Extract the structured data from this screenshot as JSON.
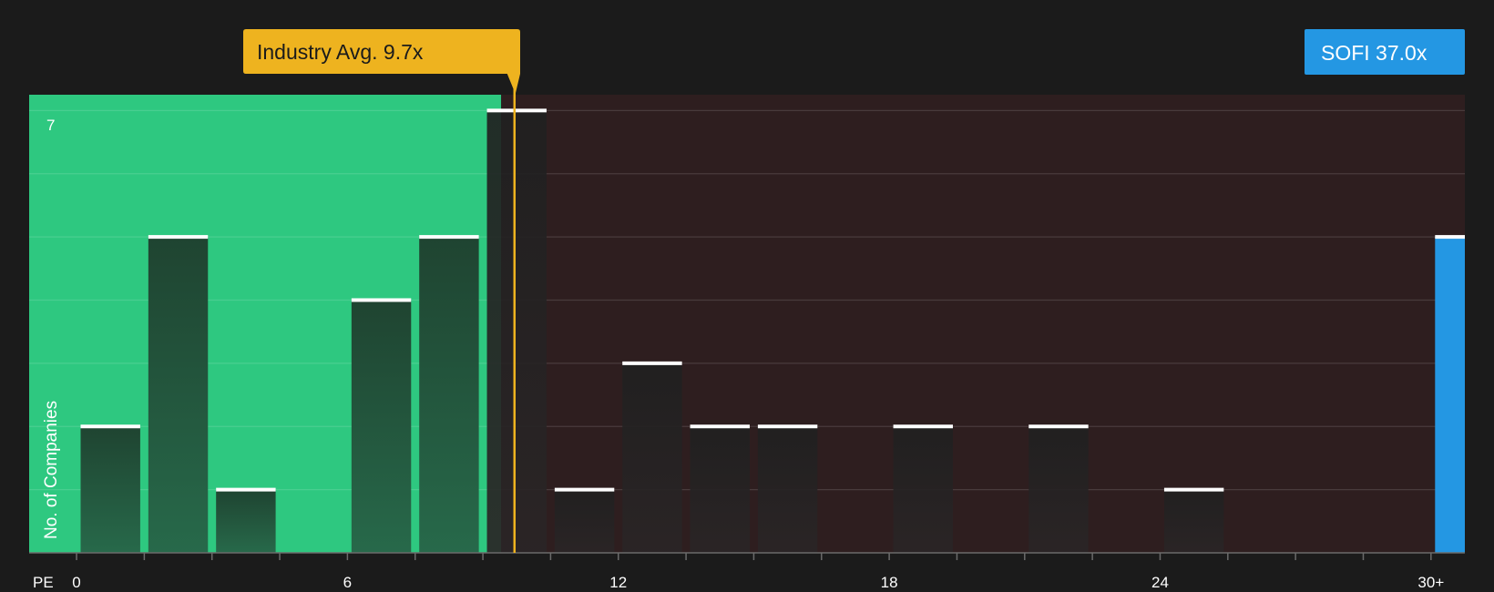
{
  "chart_data": {
    "type": "bar",
    "xlabel": "PE",
    "ylabel": "No. of Companies",
    "x_ticks": [
      "0",
      "6",
      "12",
      "18",
      "24",
      "30+"
    ],
    "x_tick_values": [
      0,
      6,
      12,
      18,
      24,
      30
    ],
    "y_tick_labels": [
      "7"
    ],
    "xlim": [
      -1.05,
      30.75
    ],
    "ylim": [
      0,
      7.25
    ],
    "bin_width": 1.5,
    "bins": [
      {
        "start": 0.0,
        "count": 2
      },
      {
        "start": 1.5,
        "count": 5
      },
      {
        "start": 3.0,
        "count": 1
      },
      {
        "start": 4.5,
        "count": 0
      },
      {
        "start": 6.0,
        "count": 4
      },
      {
        "start": 7.5,
        "count": 5
      },
      {
        "start": 9.0,
        "count": 7
      },
      {
        "start": 10.5,
        "count": 1
      },
      {
        "start": 12.0,
        "count": 3
      },
      {
        "start": 13.5,
        "count": 2
      },
      {
        "start": 15.0,
        "count": 2
      },
      {
        "start": 16.5,
        "count": 0
      },
      {
        "start": 18.0,
        "count": 2
      },
      {
        "start": 19.5,
        "count": 0
      },
      {
        "start": 21.0,
        "count": 2
      },
      {
        "start": 22.5,
        "count": 0
      },
      {
        "start": 24.0,
        "count": 1
      },
      {
        "start": 25.5,
        "count": 0
      },
      {
        "start": 27.0,
        "count": 0
      },
      {
        "start": 28.5,
        "count": 0
      }
    ],
    "highlight_bar": {
      "label": "SOFI 37.0x",
      "value": 37.0,
      "count": 5,
      "bin_start": 30.0
    },
    "industry_average": {
      "label": "Industry Avg. 9.7x",
      "value": 9.7
    },
    "colors": {
      "background": "#1b1b1b",
      "undervalued_region": "#2ec880",
      "overvalued_region": "#2e1e1f",
      "industry_avg": "#eeb31f",
      "subject": "#2497e3",
      "bar_top": "#ffffff"
    }
  }
}
